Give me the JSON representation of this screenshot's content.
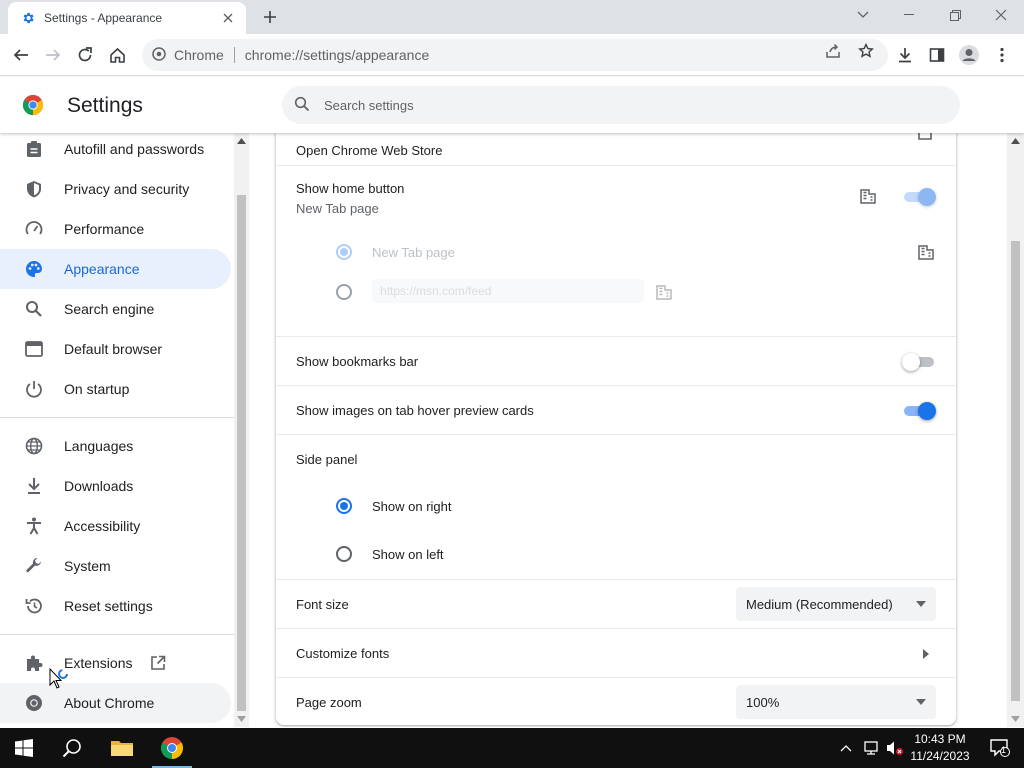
{
  "tab": {
    "title": "Settings - Appearance"
  },
  "toolbar": {
    "site_label": "Chrome",
    "url": "chrome://settings/appearance"
  },
  "header": {
    "title": "Settings",
    "search_placeholder": "Search settings"
  },
  "sidebar": {
    "items": [
      {
        "label": "Autofill and passwords",
        "icon": "clipboard-icon"
      },
      {
        "label": "Privacy and security",
        "icon": "shield-icon"
      },
      {
        "label": "Performance",
        "icon": "speedometer-icon"
      },
      {
        "label": "Appearance",
        "icon": "palette-icon",
        "active": true
      },
      {
        "label": "Search engine",
        "icon": "search-icon"
      },
      {
        "label": "Default browser",
        "icon": "browser-window-icon"
      },
      {
        "label": "On startup",
        "icon": "power-icon"
      },
      {
        "label": "Languages",
        "icon": "globe-icon"
      },
      {
        "label": "Downloads",
        "icon": "download-icon"
      },
      {
        "label": "Accessibility",
        "icon": "accessibility-icon"
      },
      {
        "label": "System",
        "icon": "wrench-icon"
      },
      {
        "label": "Reset settings",
        "icon": "reset-icon"
      },
      {
        "label": "Extensions",
        "icon": "puzzle-icon"
      },
      {
        "label": "About Chrome",
        "icon": "chrome-logo-icon"
      }
    ]
  },
  "appearance": {
    "web_store": "Open Chrome Web Store",
    "home_button": {
      "label": "Show home button",
      "sublabel": "New Tab page",
      "enabled": true,
      "option_newtab": "New Tab page",
      "custom_url": "https://msn.com/feed"
    },
    "bookmarks_bar": {
      "label": "Show bookmarks bar",
      "enabled": false
    },
    "tab_hover": {
      "label": "Show images on tab hover preview cards",
      "enabled": true
    },
    "side_panel": {
      "label": "Side panel",
      "option_right": "Show on right",
      "option_left": "Show on left",
      "selected": "right"
    },
    "font_size": {
      "label": "Font size",
      "value": "Medium (Recommended)"
    },
    "customize_fonts": {
      "label": "Customize fonts"
    },
    "page_zoom": {
      "label": "Page zoom",
      "value": "100%"
    }
  },
  "taskbar": {
    "time": "10:43 PM",
    "date": "11/24/2023",
    "notification_count": "1"
  },
  "colors": {
    "accent": "#1a73e8",
    "active_nav_bg": "#e8f0fe",
    "active_nav_text": "#1967d2",
    "taskbar": "#101010"
  }
}
